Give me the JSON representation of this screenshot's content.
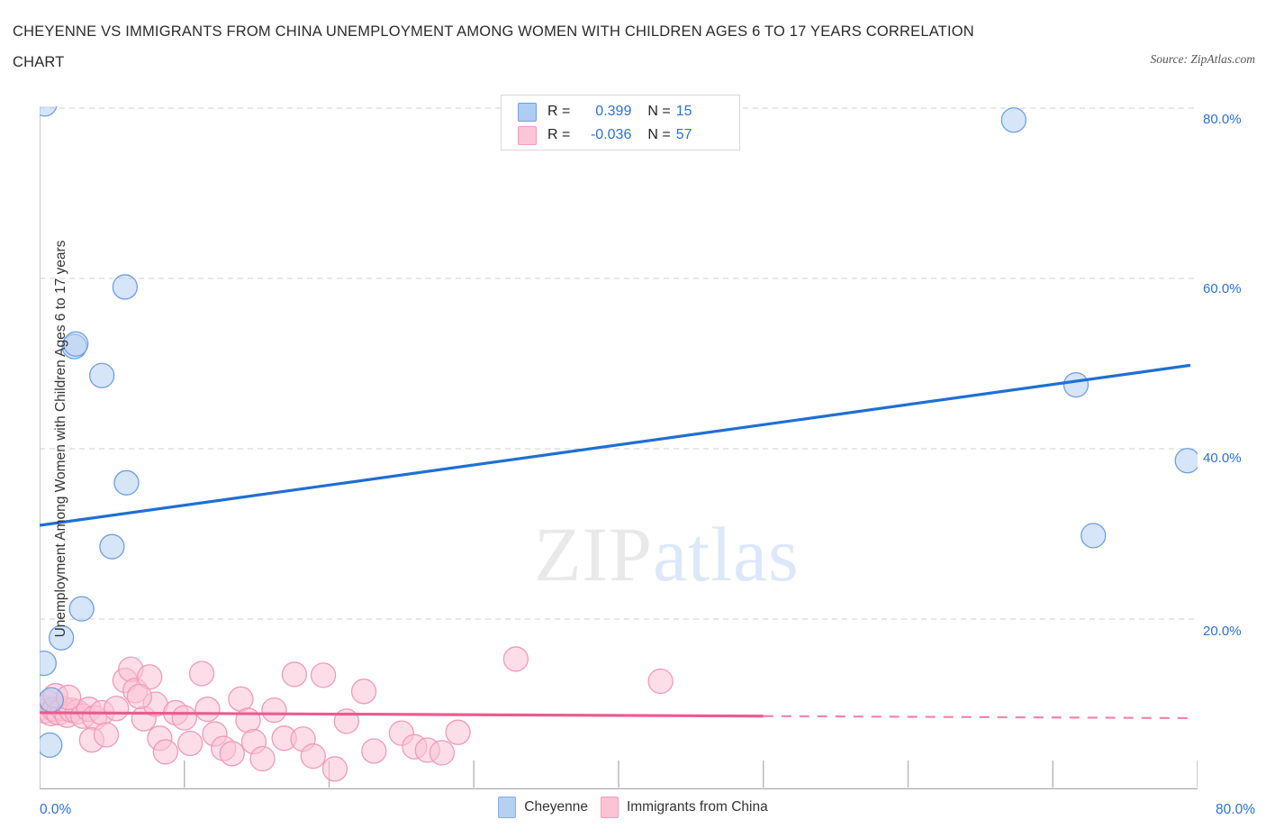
{
  "header": {
    "title_line1": "CHEYENNE VS IMMIGRANTS FROM CHINA UNEMPLOYMENT AMONG WOMEN WITH CHILDREN AGES 6 TO 17 YEARS CORRELATION",
    "title_line2": "CHART",
    "source": "Source: ZipAtlas.com"
  },
  "watermark": {
    "part1": "ZIP",
    "part2": "atlas"
  },
  "stats_legend": {
    "rows": [
      {
        "series": "Cheyenne",
        "color": "#aecdf2",
        "r_label": "R =",
        "r_value": "0.399",
        "n_label": "N =",
        "n_value": "15"
      },
      {
        "series": "Immigrants from China",
        "color": "#fbc7d8",
        "r_label": "R =",
        "r_value": "-0.036",
        "n_label": "N =",
        "n_value": "57"
      }
    ]
  },
  "bottom_legend": {
    "items": [
      {
        "label": "Cheyenne",
        "color": "#b6d0f2"
      },
      {
        "label": "Immigrants from China",
        "color": "#fcc3d5"
      }
    ]
  },
  "axes": {
    "y_title": "Unemployment Among Women with Children Ages 6 to 17 years",
    "y_ticks": [
      "80.0%",
      "60.0%",
      "40.0%",
      "20.0%"
    ],
    "x_min_label": "0.0%",
    "x_max_label": "80.0%"
  },
  "chart_data": {
    "type": "scatter",
    "title": "CHEYENNE VS IMMIGRANTS FROM CHINA UNEMPLOYMENT AMONG WOMEN WITH CHILDREN AGES 6 TO 17 YEARS CORRELATION CHART",
    "xlabel": "",
    "ylabel": "Unemployment Among Women with Children Ages 6 to 17 years",
    "xlim": [
      0,
      80
    ],
    "ylim": [
      0,
      80.5
    ],
    "grid": true,
    "legend_position": "bottom-center",
    "series": [
      {
        "name": "Cheyenne",
        "color": "#b6d0f2",
        "edge_color": "#6d9fe0",
        "r": 0.399,
        "n": 15,
        "trend": {
          "x0": 0,
          "y0": 31.0,
          "x1": 79.5,
          "y1": 49.8,
          "style": "solid",
          "color": "#1f6fd4"
        },
        "points": [
          {
            "x": 0.35,
            "y": 80.5
          },
          {
            "x": 5.9,
            "y": 59.0
          },
          {
            "x": 2.4,
            "y": 52.0
          },
          {
            "x": 2.5,
            "y": 52.3
          },
          {
            "x": 4.3,
            "y": 48.6
          },
          {
            "x": 6.0,
            "y": 36.0
          },
          {
            "x": 5.0,
            "y": 28.5
          },
          {
            "x": 2.9,
            "y": 21.2
          },
          {
            "x": 1.5,
            "y": 17.8
          },
          {
            "x": 0.3,
            "y": 14.8
          },
          {
            "x": 0.8,
            "y": 10.5
          },
          {
            "x": 0.7,
            "y": 5.2
          },
          {
            "x": 67.3,
            "y": 78.6
          },
          {
            "x": 71.6,
            "y": 47.5
          },
          {
            "x": 72.8,
            "y": 29.8
          },
          {
            "x": 79.3,
            "y": 38.6
          }
        ]
      },
      {
        "name": "Immigrants from China",
        "color": "#fcc3d5",
        "edge_color": "#ef9ab8",
        "r": -0.036,
        "n": 57,
        "trend": {
          "x0": 0,
          "y0": 9.0,
          "x1": 50.0,
          "y1": 8.6,
          "style": "solid-then-dashed",
          "dash_start": 50.0,
          "dash_end": 79.5,
          "color": "#ea5c8f"
        },
        "points": [
          {
            "x": 0.2,
            "y": 9.6
          },
          {
            "x": 0.4,
            "y": 9.2
          },
          {
            "x": 0.6,
            "y": 10.2
          },
          {
            "x": 0.8,
            "y": 8.9
          },
          {
            "x": 1.0,
            "y": 9.4
          },
          {
            "x": 1.3,
            "y": 9.0
          },
          {
            "x": 1.6,
            "y": 9.5
          },
          {
            "x": 1.9,
            "y": 8.7
          },
          {
            "x": 2.2,
            "y": 9.3
          },
          {
            "x": 2.6,
            "y": 9.1
          },
          {
            "x": 3.0,
            "y": 8.6
          },
          {
            "x": 3.4,
            "y": 9.4
          },
          {
            "x": 3.8,
            "y": 8.4
          },
          {
            "x": 4.3,
            "y": 9.0
          },
          {
            "x": 3.6,
            "y": 5.8
          },
          {
            "x": 4.6,
            "y": 6.4
          },
          {
            "x": 5.3,
            "y": 9.5
          },
          {
            "x": 5.9,
            "y": 12.8
          },
          {
            "x": 6.3,
            "y": 14.1
          },
          {
            "x": 6.6,
            "y": 11.6
          },
          {
            "x": 7.2,
            "y": 8.3
          },
          {
            "x": 7.6,
            "y": 13.2
          },
          {
            "x": 8.0,
            "y": 10.0
          },
          {
            "x": 8.3,
            "y": 6.0
          },
          {
            "x": 8.7,
            "y": 4.4
          },
          {
            "x": 9.4,
            "y": 9.0
          },
          {
            "x": 10.0,
            "y": 8.4
          },
          {
            "x": 10.4,
            "y": 5.4
          },
          {
            "x": 11.2,
            "y": 13.6
          },
          {
            "x": 11.6,
            "y": 9.4
          },
          {
            "x": 12.1,
            "y": 6.5
          },
          {
            "x": 12.7,
            "y": 4.8
          },
          {
            "x": 13.3,
            "y": 4.2
          },
          {
            "x": 13.9,
            "y": 10.6
          },
          {
            "x": 14.4,
            "y": 8.1
          },
          {
            "x": 14.8,
            "y": 5.6
          },
          {
            "x": 15.4,
            "y": 3.6
          },
          {
            "x": 16.2,
            "y": 9.3
          },
          {
            "x": 16.9,
            "y": 6.0
          },
          {
            "x": 17.6,
            "y": 13.5
          },
          {
            "x": 18.2,
            "y": 5.9
          },
          {
            "x": 18.9,
            "y": 3.9
          },
          {
            "x": 19.6,
            "y": 13.4
          },
          {
            "x": 20.4,
            "y": 2.4
          },
          {
            "x": 21.2,
            "y": 8.0
          },
          {
            "x": 22.4,
            "y": 11.5
          },
          {
            "x": 23.1,
            "y": 4.5
          },
          {
            "x": 25.0,
            "y": 6.6
          },
          {
            "x": 25.9,
            "y": 5.0
          },
          {
            "x": 26.8,
            "y": 4.6
          },
          {
            "x": 27.8,
            "y": 4.3
          },
          {
            "x": 28.9,
            "y": 6.7
          },
          {
            "x": 32.9,
            "y": 15.3
          },
          {
            "x": 42.9,
            "y": 12.7
          },
          {
            "x": 1.1,
            "y": 11.0
          },
          {
            "x": 2.0,
            "y": 10.8
          },
          {
            "x": 6.9,
            "y": 10.9
          }
        ]
      }
    ]
  }
}
